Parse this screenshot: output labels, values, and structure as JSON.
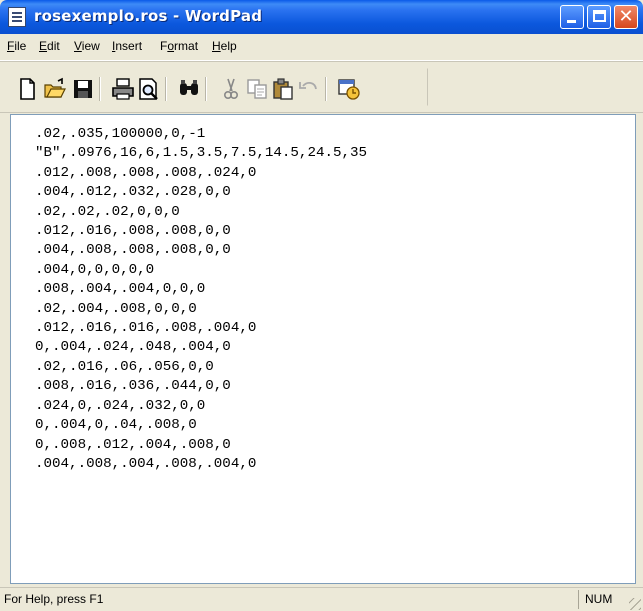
{
  "window": {
    "title": "rosexemplo.ros - WordPad",
    "controls": {
      "minimize_icon": "minimize-icon",
      "maximize_icon": "maximize-icon",
      "close_icon": "close-icon"
    }
  },
  "menu": [
    {
      "label": "File",
      "underline": "F",
      "rest": "ile"
    },
    {
      "label": "Edit",
      "underline": "E",
      "rest": "dit"
    },
    {
      "label": "View",
      "underline": "V",
      "rest": "iew"
    },
    {
      "label": "Insert",
      "underline": "I",
      "rest": "nsert"
    },
    {
      "label": "Format",
      "pre": "F",
      "underline": "o",
      "rest": "rmat"
    },
    {
      "label": "Help",
      "underline": "H",
      "rest": "elp"
    }
  ],
  "toolbar": {
    "icons": [
      "new-icon",
      "open-icon",
      "save-icon",
      "print-icon",
      "print-preview-icon",
      "find-icon",
      "cut-icon",
      "copy-icon",
      "paste-icon",
      "undo-icon",
      "date-time-icon"
    ]
  },
  "document": {
    "lines": [
      ".02,.035,100000,0,-1",
      "\"B\",.0976,16,6,1.5,3.5,7.5,14.5,24.5,35",
      ".012,.008,.008,.008,.024,0",
      ".004,.012,.032,.028,0,0",
      ".02,.02,.02,0,0,0",
      ".012,.016,.008,.008,0,0",
      ".004,.008,.008,.008,0,0",
      ".004,0,0,0,0,0",
      ".008,.004,.004,0,0,0",
      ".02,.004,.008,0,0,0",
      ".012,.016,.016,.008,.004,0",
      "0,.004,.024,.048,.004,0",
      ".02,.016,.06,.056,0,0",
      ".008,.016,.036,.044,0,0",
      ".024,0,.024,.032,0,0",
      "0,.004,0,.04,.008,0",
      "0,.008,.012,.004,.008,0",
      ".004,.008,.004,.008,.004,0"
    ]
  },
  "status": {
    "help_text": "For Help, press F1",
    "num_indicator": "NUM"
  },
  "colors": {
    "titlebar": "#0a58dd",
    "chrome": "#ece9d8",
    "document_bg": "#ffffff"
  }
}
